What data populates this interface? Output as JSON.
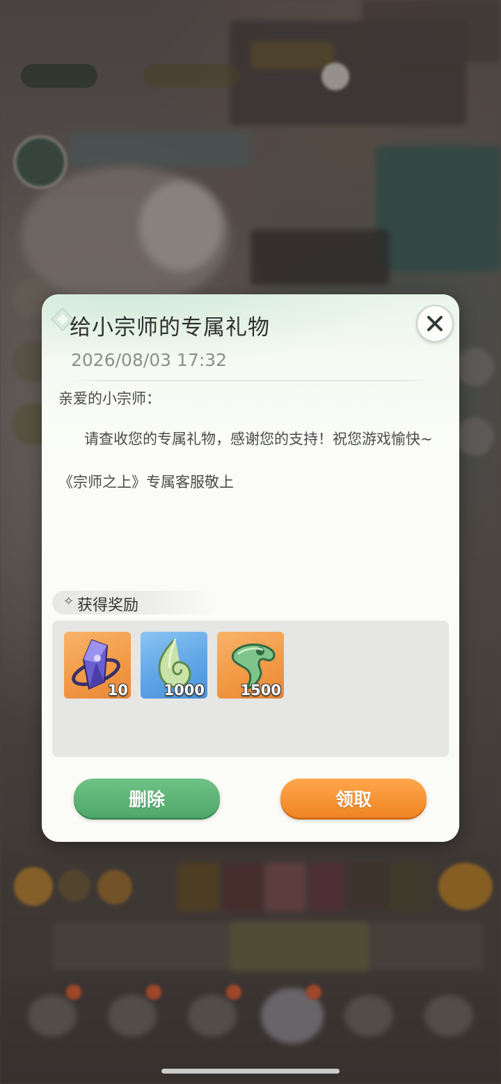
{
  "mail": {
    "title": "给小宗师的专属礼物",
    "date": "2026/08/03 17:32",
    "greeting": "亲爱的小宗师：",
    "message": "请查收您的专属礼物，感谢您的支持！祝您游戏愉快~",
    "signature": "《宗师之上》专属客服敬上"
  },
  "rewards": {
    "header": "获得奖励",
    "items": [
      {
        "icon": "purple-crystal-icon",
        "quantity": "10",
        "frame_color": "#f29b47"
      },
      {
        "icon": "jade-token-icon",
        "quantity": "1000",
        "frame_color": "#5fa5e6"
      },
      {
        "icon": "jade-pendant-icon",
        "quantity": "1500",
        "frame_color": "#f29b47"
      }
    ]
  },
  "buttons": {
    "delete": "删除",
    "claim": "领取"
  },
  "colors": {
    "delete_button": "#4fa86a",
    "claim_button": "#f08525",
    "dialog_bg": "#fbfbf7"
  }
}
